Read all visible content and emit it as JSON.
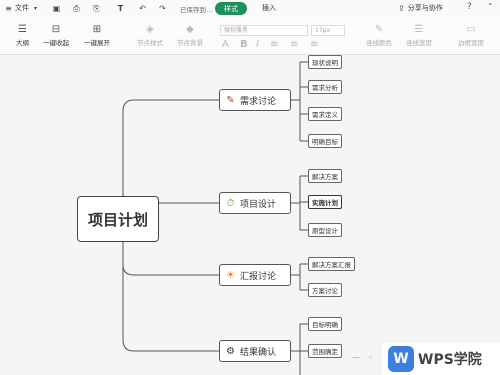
{
  "menubar": {
    "file_label": "文件",
    "saved_text": "已保存到...",
    "tab_style": "样式",
    "tab_insert": "插入",
    "share_label": "分享与协作",
    "help_label": "?"
  },
  "toolbar": {
    "outline_label": "大纲",
    "collapse_label": "一键收起",
    "expand_label": "一键展开",
    "node_style_label": "节点样式",
    "node_bg_label": "节点背景",
    "font_placeholder": "微软雅黑",
    "size_placeholder": "17px",
    "line_color_label": "连线颜色",
    "line_width_label": "连线宽度",
    "border_width_label": "边框宽度"
  },
  "mindmap": {
    "root": "项目计划",
    "branches": [
      {
        "label": "需求讨论",
        "icon": "pencil-icon",
        "color": "#c0392b",
        "leaves": [
          "现状说明",
          "需求分析",
          "需求定义",
          "明确目标"
        ]
      },
      {
        "label": "项目设计",
        "icon": "timer-icon",
        "color": "#5aa02c",
        "leaves": [
          "解决方案",
          "实施计划",
          "原型设计"
        ]
      },
      {
        "label": "汇报讨论",
        "icon": "bulb-icon",
        "color": "#e67e22",
        "leaves": [
          "解决方案汇报",
          "方案讨论"
        ]
      },
      {
        "label": "结果确认",
        "icon": "gear-icon",
        "color": "#333333",
        "leaves": [
          "目标明确",
          "范围确定"
        ]
      }
    ]
  },
  "watermark": {
    "logo_letter": "W",
    "text": "WPS学院"
  }
}
